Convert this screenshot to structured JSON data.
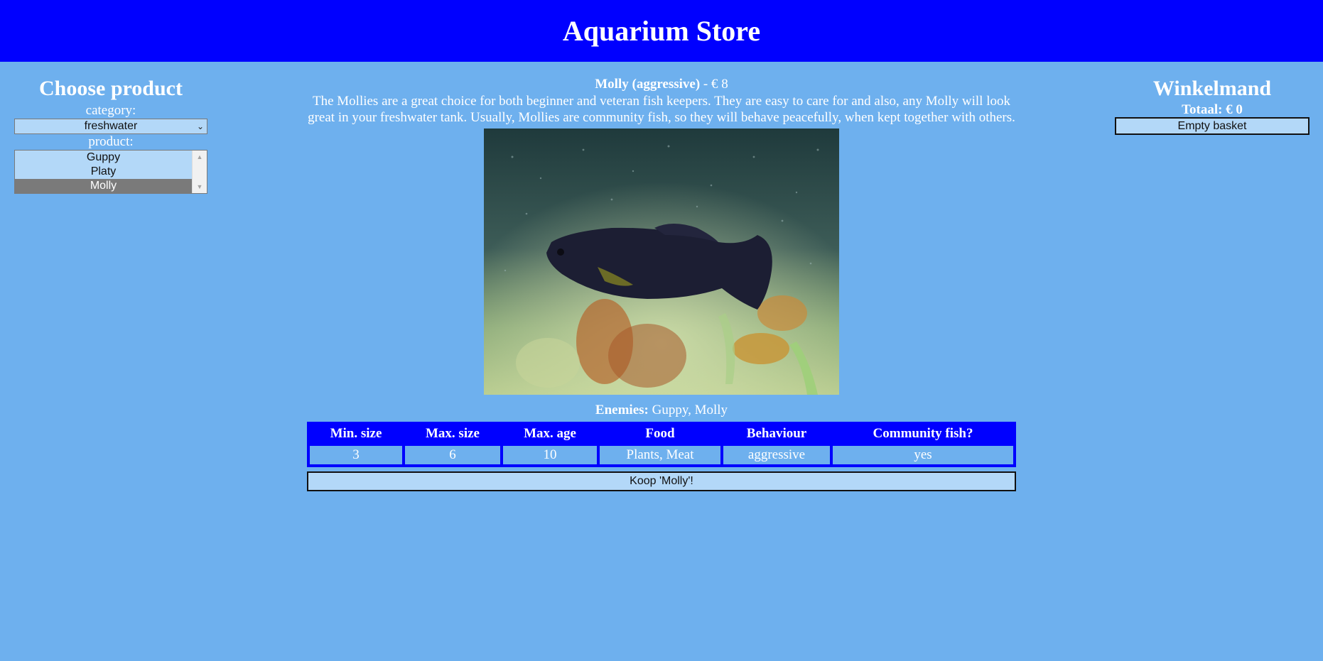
{
  "header": {
    "title": "Aquarium Store"
  },
  "left_panel": {
    "heading": "Choose product",
    "category_label": "category:",
    "category_value": "freshwater",
    "product_label": "product:",
    "products": [
      "Guppy",
      "Platy",
      "Molly"
    ],
    "selected_product": "Molly"
  },
  "product": {
    "name_behaviour": "Molly (aggressive)",
    "price_text": "- € 8",
    "description": "The Mollies are a great choice for both beginner and veteran fish keepers. They are easy to care for and also, any Molly will look great in your freshwater tank. Usually, Mollies are community fish, so they will behave peacefully, when kept together with others.",
    "enemies_label": "Enemies:",
    "enemies_value": "Guppy, Molly"
  },
  "specs": {
    "headers": [
      "Min. size",
      "Max. size",
      "Max. age",
      "Food",
      "Behaviour",
      "Community fish?"
    ],
    "values": [
      "3",
      "6",
      "10",
      "Plants, Meat",
      "aggressive",
      "yes"
    ]
  },
  "buy_button": "Koop 'Molly'!",
  "basket": {
    "heading": "Winkelmand",
    "total": "Totaal: € 0",
    "empty_button": "Empty basket"
  },
  "colors": {
    "header_bg": "#0000ff",
    "page_bg": "#6eb0ee",
    "control_bg": "#b3d8f8"
  }
}
